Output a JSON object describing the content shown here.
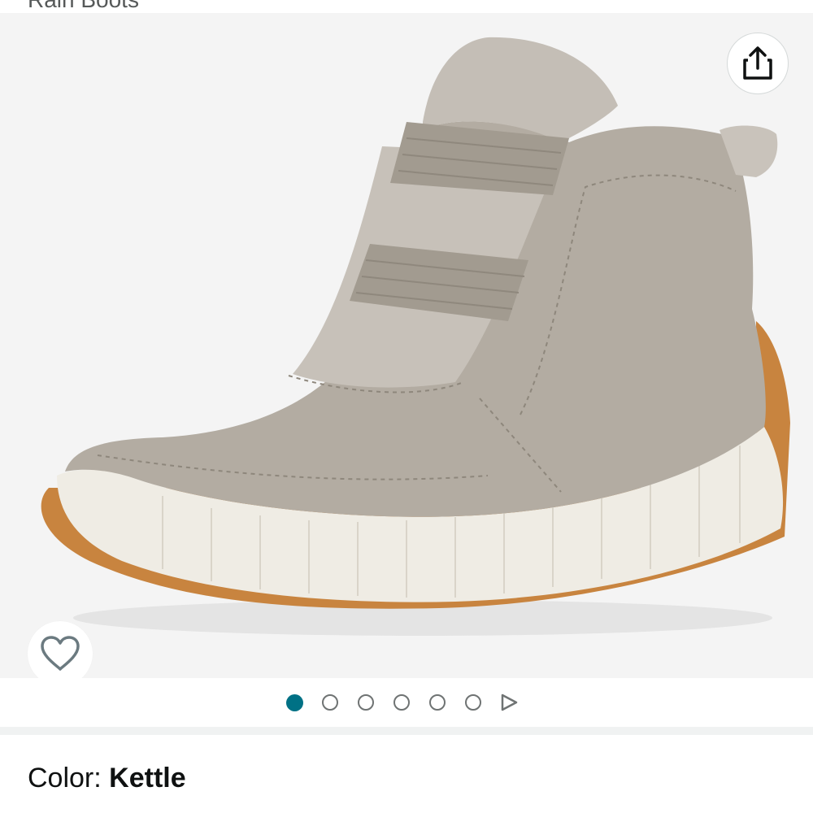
{
  "header": {
    "breadcrumb": "Rain Boots"
  },
  "gallery": {
    "image_alt": "Sorel women's slip-on suede boot",
    "share_icon": "share-icon",
    "wishlist_icon": "heart-outline-icon",
    "total_images": 6,
    "active_index": 0,
    "accent_color": "#007185"
  },
  "product": {
    "color_label": "Color:",
    "color_value": "Kettle"
  }
}
